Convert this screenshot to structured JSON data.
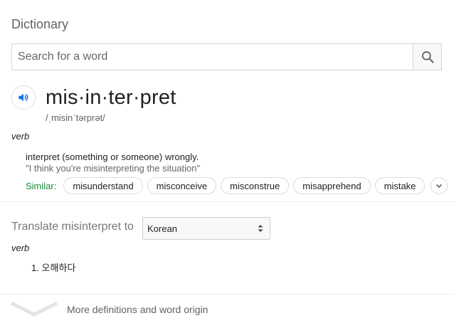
{
  "header": {
    "title": "Dictionary"
  },
  "search": {
    "placeholder": "Search for a word",
    "icon": "search-icon"
  },
  "entry": {
    "word": "mis·in·ter·pret",
    "phonetic": "/ˌmisinˈtərprət/",
    "part_of_speech": "verb",
    "definition": "interpret (something or someone) wrongly.",
    "example": "\"I think you're misinterpreting the situation\"",
    "similar_label": "Similar:",
    "similar": [
      "misunderstand",
      "misconceive",
      "misconstrue",
      "misapprehend",
      "mistake"
    ]
  },
  "translate": {
    "label": "Translate misinterpret to",
    "language": "Korean",
    "part_of_speech": "verb",
    "items": [
      "1. 오해하다"
    ]
  },
  "footer": {
    "more_label": "More definitions and word origin"
  },
  "colors": {
    "accent_blue": "#1a73e8",
    "similar_green": "#1e8c3a",
    "muted_text": "#5f6368"
  }
}
